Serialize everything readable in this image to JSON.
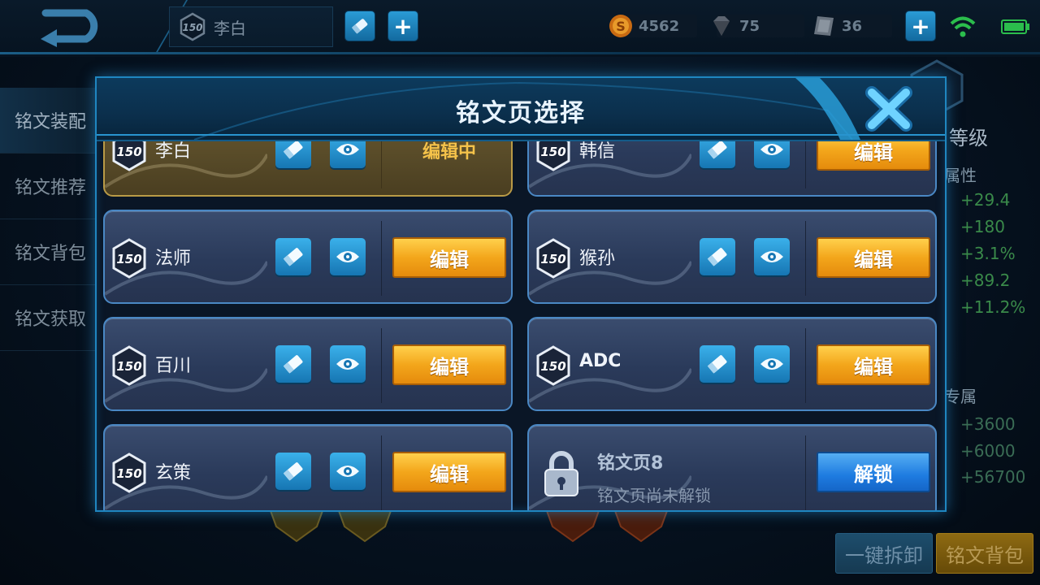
{
  "topbar": {
    "current_page_level": "150",
    "current_page_name": "李白",
    "gold": "4562",
    "diamond": "75",
    "coupon": "36"
  },
  "left_nav": [
    {
      "label": "铭文装配"
    },
    {
      "label": "铭文推荐"
    },
    {
      "label": "铭文背包"
    },
    {
      "label": "铭文获取"
    }
  ],
  "right_panel": {
    "title": "等级",
    "attr_label": "属性",
    "attr_values": [
      "+29.4",
      "+180",
      "+3.1%",
      "+89.2",
      "+11.2%"
    ],
    "exclusive_label": "专属",
    "exclusive_values": [
      "+3600",
      "+6000",
      "+56700"
    ]
  },
  "bottom": {
    "unequip_label": "一键拆卸",
    "bag_label": "铭文背包"
  },
  "modal": {
    "title": "铭文页选择",
    "pages": [
      {
        "level": "150",
        "name": "李白",
        "action": "编辑中",
        "current": true
      },
      {
        "level": "150",
        "name": "韩信",
        "action": "编辑"
      },
      {
        "level": "150",
        "name": "法师",
        "action": "编辑"
      },
      {
        "level": "150",
        "name": "猴孙",
        "action": "编辑"
      },
      {
        "level": "150",
        "name": "百川",
        "action": "编辑"
      },
      {
        "level": "150",
        "name": "ADC",
        "action": "编辑"
      },
      {
        "level": "150",
        "name": "玄策",
        "action": "编辑"
      }
    ],
    "locked_page": {
      "title": "铭文页8",
      "subtitle": "铭文页尚未解锁",
      "action": "解锁"
    }
  },
  "colors": {
    "accent_blue": "#1f86c0",
    "edit_orange": "#f3a61b",
    "unlock_blue": "#1e7be0",
    "current_gold": "#b99a46"
  }
}
